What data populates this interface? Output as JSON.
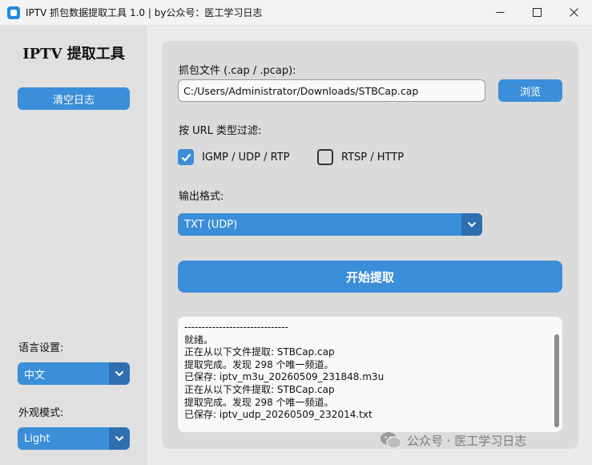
{
  "window": {
    "title": "IPTV 抓包数据提取工具 1.0 | by公众号：医工学习日志",
    "controls": {
      "minimize": "—",
      "maximize": "☐",
      "close": "✕"
    }
  },
  "sidebar": {
    "app_title": "IPTV 提取工具",
    "clear_log_label": "清空日志",
    "language_label": "语言设置:",
    "language_value": "中文",
    "appearance_label": "外观模式:",
    "appearance_value": "Light"
  },
  "main": {
    "file_label": "抓包文件 (.cap / .pcap):",
    "file_path": "C:/Users/Administrator/Downloads/STBCap.cap",
    "browse_label": "浏览",
    "filter_label": "按 URL 类型过滤:",
    "filters": [
      {
        "label": "IGMP / UDP / RTP",
        "checked": true
      },
      {
        "label": "RTSP / HTTP",
        "checked": false
      }
    ],
    "output_label": "输出格式:",
    "output_value": "TXT (UDP)",
    "start_label": "开始提取"
  },
  "log": {
    "lines": [
      "------------------------------",
      "就绪。",
      "正在从以下文件提取: STBCap.cap",
      "提取完成。发现 298 个唯一频道。",
      "已保存: iptv_m3u_20260509_231848.m3u",
      "正在从以下文件提取: STBCap.cap",
      "提取完成。发现 298 个唯一频道。",
      "已保存: iptv_udp_20260509_232014.txt"
    ]
  },
  "watermark": {
    "text": "公众号 · 医工学习日志"
  },
  "colors": {
    "accent": "#3b8ed8",
    "accent_dark": "#2f6fb0",
    "panel": "#dbdbdb",
    "sidebar": "#e0e0e0"
  }
}
